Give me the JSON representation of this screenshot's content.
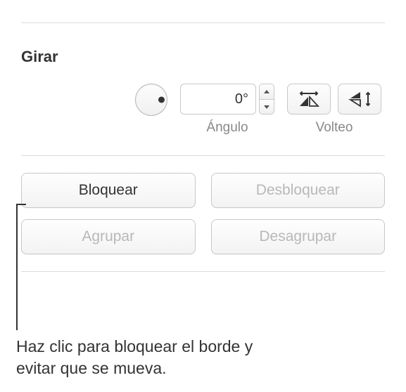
{
  "section": {
    "title": "Girar"
  },
  "angle": {
    "value": "0°",
    "label": "Ángulo"
  },
  "flip": {
    "label": "Volteo"
  },
  "buttons": {
    "lock": "Bloquear",
    "unlock": "Desbloquear",
    "group": "Agrupar",
    "ungroup": "Desagrupar"
  },
  "callout": {
    "text": "Haz clic para bloquear el borde y evitar que se mueva."
  }
}
